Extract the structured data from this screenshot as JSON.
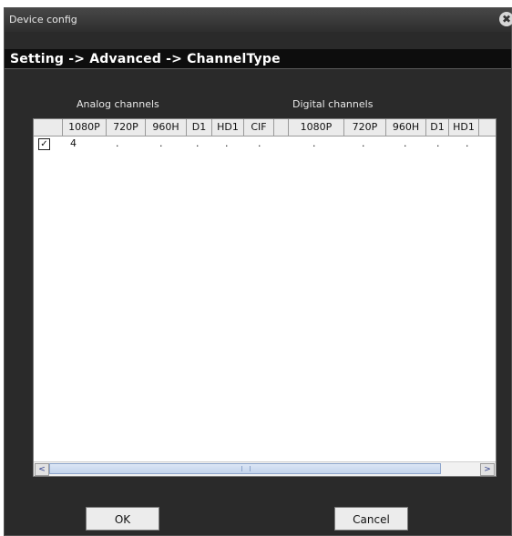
{
  "window": {
    "title": "Device config",
    "close_glyph": "✖"
  },
  "breadcrumb": "Setting -> Advanced -> ChannelType",
  "groups": {
    "analog_label": "Analog channels",
    "digital_label": "Digital channels"
  },
  "table": {
    "columns": [
      "",
      "1080P",
      "720P",
      "960H",
      "D1",
      "HD1",
      "CIF",
      "",
      "1080P",
      "720P",
      "960H",
      "D1",
      "HD1"
    ],
    "rows": [
      {
        "checked": true,
        "check_glyph": "✓",
        "cells": [
          "4",
          ".",
          ".",
          ".",
          ".",
          ".",
          "",
          ".",
          ".",
          ".",
          ".",
          "."
        ]
      }
    ]
  },
  "scrollbar": {
    "left_arrow": "<",
    "right_arrow": ">"
  },
  "buttons": {
    "ok_label": "OK",
    "cancel_label": "Cancel"
  }
}
